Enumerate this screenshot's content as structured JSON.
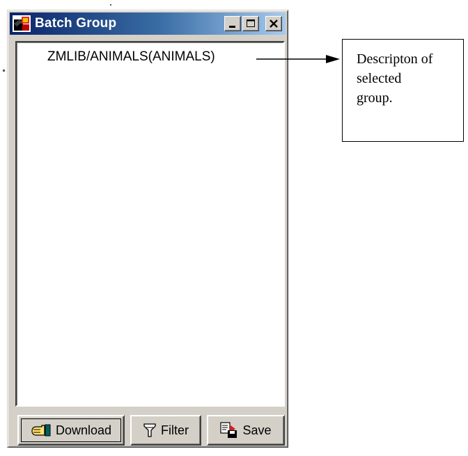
{
  "window": {
    "title": "Batch Group",
    "controls": {
      "minimize": "minimize",
      "maximize": "maximize",
      "close": "close"
    }
  },
  "list": {
    "items": [
      {
        "label": "ZMLIB/ANIMALS(ANIMALS)"
      }
    ]
  },
  "buttons": {
    "download": "Download",
    "filter": "Filter",
    "save": "Save"
  },
  "annotation": {
    "lines": [
      "Descripton of",
      "selected",
      "group."
    ]
  },
  "colors": {
    "title_bar_start": "#0a246a",
    "title_bar_end": "#a6caf0",
    "window_face": "#d4d0c8"
  }
}
